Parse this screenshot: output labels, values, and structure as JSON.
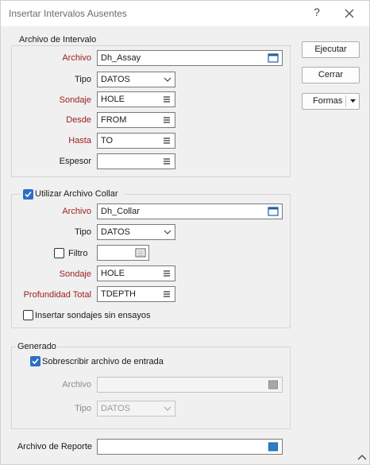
{
  "window": {
    "title": "Insertar Intervalos Ausentes"
  },
  "buttons": {
    "execute": "Ejecutar",
    "close": "Cerrar",
    "forms": "Formas"
  },
  "interval": {
    "group_title": "Archivo de Intervalo",
    "archivo_label": "Archivo",
    "archivo_value": "Dh_Assay",
    "tipo_label": "Tipo",
    "tipo_value": "DATOS",
    "sondaje_label": "Sondaje",
    "sondaje_value": "HOLE",
    "desde_label": "Desde",
    "desde_value": "FROM",
    "hasta_label": "Hasta",
    "hasta_value": "TO",
    "espesor_label": "Espesor",
    "espesor_value": ""
  },
  "collar": {
    "checkbox_label": "Utilizar Archivo Collar",
    "checked": true,
    "archivo_label": "Archivo",
    "archivo_value": "Dh_Collar",
    "tipo_label": "Tipo",
    "tipo_value": "DATOS",
    "filtro_label": "Filtro",
    "filtro_checked": false,
    "filtro_value": "",
    "sondaje_label": "Sondaje",
    "sondaje_value": "HOLE",
    "profundidad_label": "Profundidad Total",
    "profundidad_value": "TDEPTH",
    "insert_label": "Insertar sondajes sin ensayos",
    "insert_checked": false
  },
  "output": {
    "group_title": "Generado",
    "overwrite_label": "Sobrescribir archivo de entrada",
    "overwrite_checked": true,
    "archivo_label": "Archivo",
    "archivo_value": "",
    "tipo_label": "Tipo",
    "tipo_value": "DATOS"
  },
  "report": {
    "label": "Archivo de Reporte",
    "value": ""
  },
  "colors": {
    "required_label": "#9b1c1c",
    "accent": "#2a6fc7",
    "disabled_text": "#8a8a8a"
  }
}
